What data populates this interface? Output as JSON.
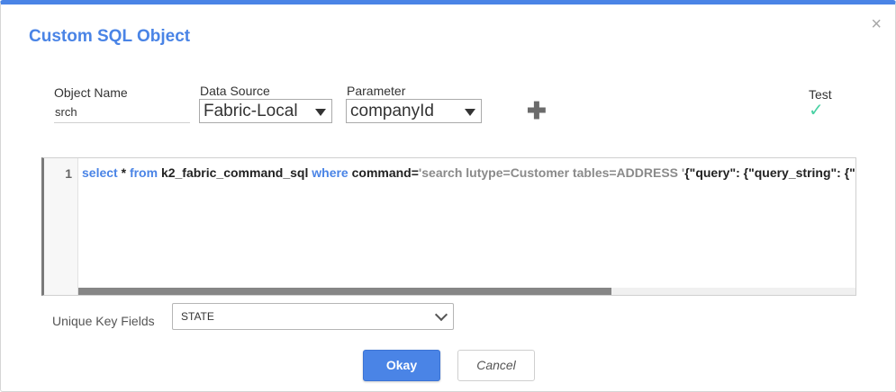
{
  "dialog": {
    "title": "Custom SQL Object",
    "close_glyph": "×"
  },
  "form": {
    "object_name": {
      "label": "Object Name",
      "value": "srch"
    },
    "data_source": {
      "label": "Data Source",
      "value": "Fabric-Local"
    },
    "parameter": {
      "label": "Parameter",
      "value": "companyId"
    },
    "add_glyph": "✚",
    "test": {
      "label": "Test",
      "glyph": "✓"
    }
  },
  "editor": {
    "line_number": "1",
    "tokens": [
      {
        "type": "kw",
        "text": "select"
      },
      {
        "type": "plain",
        "text": " * "
      },
      {
        "type": "kw",
        "text": "from"
      },
      {
        "type": "plain",
        "text": " k2_fabric_command_sql "
      },
      {
        "type": "kw",
        "text": "where"
      },
      {
        "type": "plain",
        "text": " command="
      },
      {
        "type": "str",
        "text": "'search lutype=Customer tables=ADDRESS '"
      },
      {
        "type": "plain",
        "text": "{\"query\": {\"query_string\": {\"query\": \"*"
      }
    ]
  },
  "unique_key": {
    "label": "Unique Key Fields",
    "value": "STATE"
  },
  "buttons": {
    "okay": "Okay",
    "cancel": "Cancel"
  },
  "colors": {
    "accent": "#4a84e6",
    "test_check": "#4ad1a4"
  },
  "icons": {
    "close": "close-icon",
    "plus": "plus-icon",
    "check": "check-icon",
    "caret": "caret-down-icon",
    "chevron": "chevron-down-icon"
  }
}
